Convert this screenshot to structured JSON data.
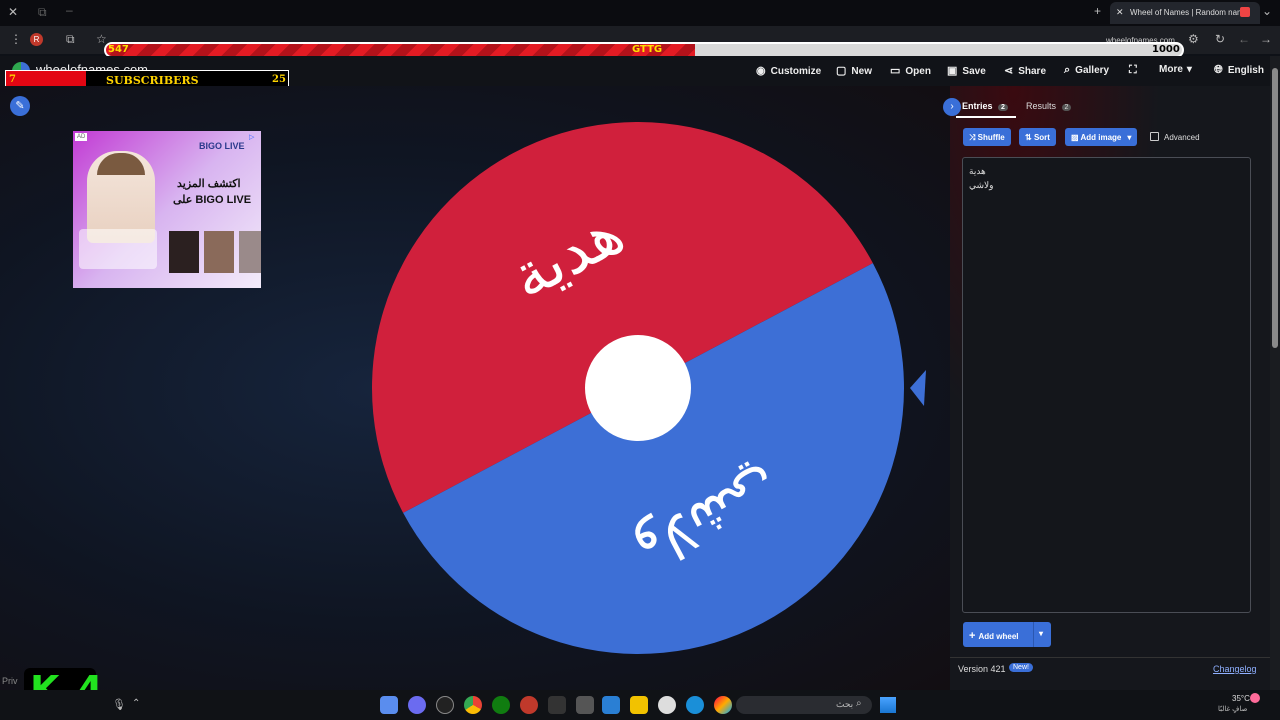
{
  "browser": {
    "tab_title": "Wheel of Names | Random nam",
    "url": "wheelofnames.com"
  },
  "overlay": {
    "left_value": "547",
    "center_label": "GTTG",
    "right_value": "1000",
    "progress": 0.547,
    "subs_left": "7",
    "subs_label": "SUBSCRIBERS",
    "subs_right": "25"
  },
  "nav": {
    "logo": "wheelofnames.com",
    "customize": "Customize",
    "new": "New",
    "open": "Open",
    "save": "Save",
    "share": "Share",
    "gallery": "Gallery",
    "more": "More",
    "language": "English"
  },
  "ad": {
    "badge": "AD",
    "brand": "BIGO LIVE",
    "headline1": "اكتشف المزيد",
    "headline2": "على BIGO LIVE"
  },
  "wheel": {
    "segments": [
      {
        "label": "هدية",
        "color": "#d0203c"
      },
      {
        "label": "ولاشي",
        "color": "#3d6fd6"
      }
    ]
  },
  "panel": {
    "tab_entries": "Entries",
    "entries_count": "2",
    "tab_results": "Results",
    "results_count": "2",
    "shuffle": "Shuffle",
    "sort": "Sort",
    "add_image": "Add image",
    "advanced": "Advanced",
    "entries": [
      "هدية",
      "ولاشي"
    ],
    "add_wheel": "Add wheel",
    "version": "Version 421",
    "new_badge": "New!",
    "changelog": "Changelog"
  },
  "footer": {
    "privacy": "Priv",
    "k4": "K 4"
  },
  "taskbar": {
    "search": "بحث",
    "temp": "35°C",
    "weather": "صافٍ غالبًا"
  }
}
